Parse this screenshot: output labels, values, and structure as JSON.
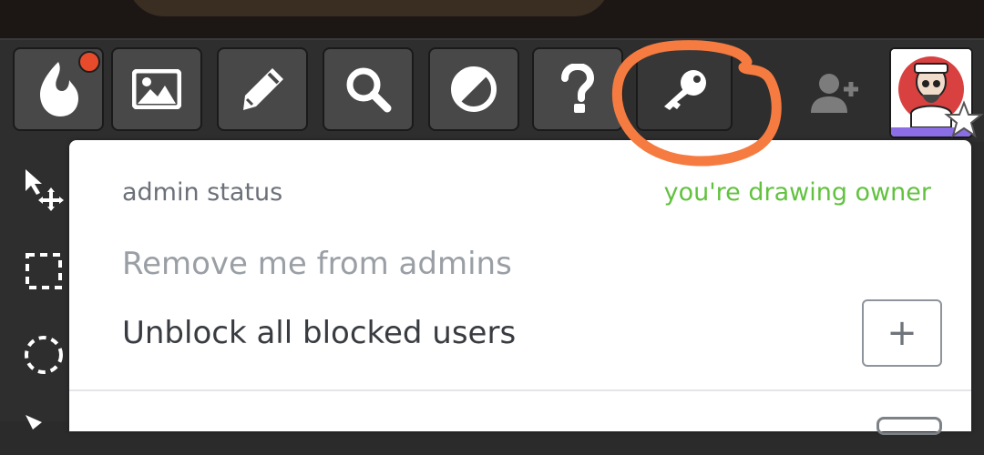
{
  "toolbar": {
    "tools": [
      {
        "name": "logo-drop-icon",
        "notification": true
      },
      {
        "name": "image-icon"
      },
      {
        "name": "pencil-icon"
      },
      {
        "name": "search-icon"
      },
      {
        "name": "contrast-icon"
      },
      {
        "name": "help-icon"
      },
      {
        "name": "key-icon",
        "active": true
      }
    ],
    "add_user_icon": "person-add-icon",
    "avatar_icon": "user-avatar",
    "star_icon": "star-icon"
  },
  "side_tools": [
    "move-cursor-icon",
    "rect-select-icon",
    "lasso-select-icon"
  ],
  "admin_menu": {
    "admin_status_label": "admin status",
    "admin_status_value": "you're drawing owner",
    "remove_admin_label": "Remove me from admins",
    "unblock_label": "Unblock all blocked users",
    "unblock_button": "+"
  },
  "colors": {
    "owner_status": "#62c23f",
    "highlight": "#f57b40",
    "notification": "#e84a2c",
    "avatar_accent": "#8b6ee6"
  }
}
